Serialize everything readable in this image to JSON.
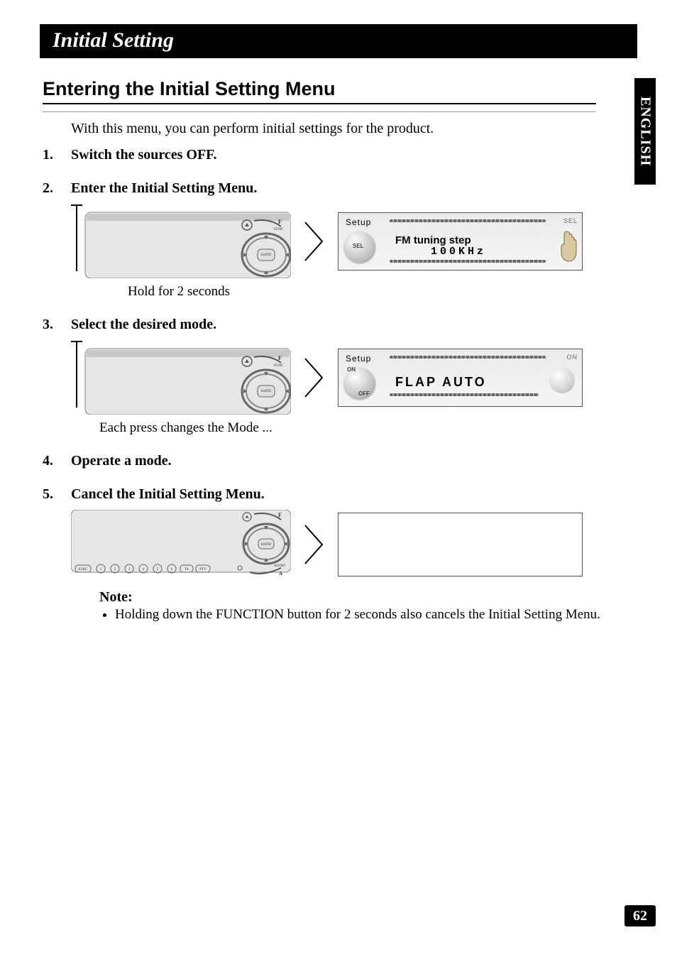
{
  "chapter_title": "Initial Setting",
  "section_title": "Entering the Initial Setting Menu",
  "intro": "With this menu, you can perform initial settings for the product.",
  "side_tab": "ENGLISH",
  "page_number": "62",
  "steps": [
    {
      "title": "Switch the sources OFF."
    },
    {
      "title": "Enter the Initial Setting Menu.",
      "caption": "Hold for 2 seconds",
      "lcd": {
        "setup": "Setup",
        "knob_label": "SEL",
        "line1": "FM tuning step",
        "line2": "100KHz",
        "right_label": "SEL"
      }
    },
    {
      "title": "Select the desired mode.",
      "caption": "Each press changes the Mode ...",
      "lcd": {
        "setup": "Setup",
        "knob_on": "ON",
        "knob_off": "OFF",
        "flap": "FLAP AUTO",
        "right_label": "ON"
      }
    },
    {
      "title": "Operate a mode."
    },
    {
      "title": "Cancel the Initial Setting Menu."
    }
  ],
  "note": {
    "title": "Note:",
    "items": [
      "Holding down the FUNCTION button for 2 seconds also cancels the Initial Setting Menu."
    ]
  },
  "panel": {
    "func_label": "F",
    "func_sub": "FUNC",
    "eject_icon": "eject-icon",
    "band_label": "BAND",
    "bottom_buttons": [
      "ESRC",
      "1",
      "2",
      "3",
      "4",
      "5",
      "6",
      "TA",
      "PTY"
    ],
    "audio_label": "AUDIO"
  }
}
